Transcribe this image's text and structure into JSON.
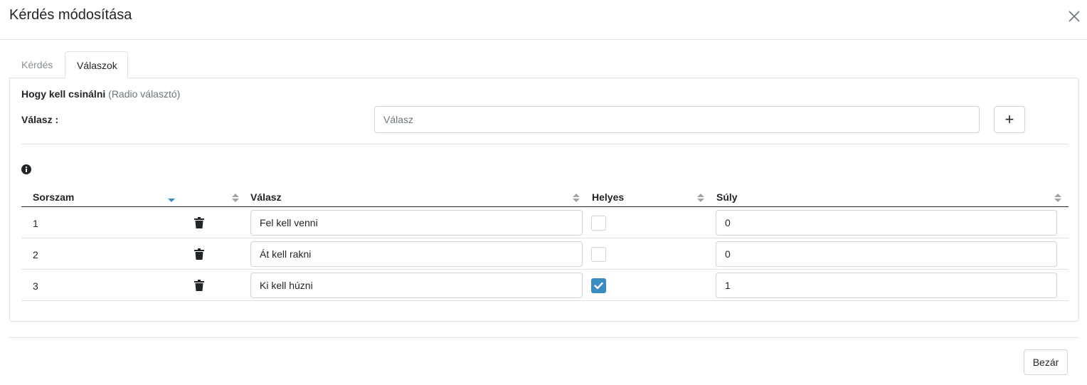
{
  "modal": {
    "title": "Kérdés módosítása",
    "close_icon": "close-icon"
  },
  "tabs": [
    {
      "label": "Kérdés",
      "active": false
    },
    {
      "label": "Válaszok",
      "active": true
    }
  ],
  "question": {
    "type_strong": "Hogy kell csinálni",
    "type_muted": "(Radio választó)"
  },
  "answer_form": {
    "label": "Válasz :",
    "input_value": "",
    "input_placeholder": "Válasz",
    "add_button_label": "+"
  },
  "info_icon": "info-circle-icon",
  "table": {
    "columns": [
      "Sorszam",
      "Válasz",
      "Helyes",
      "Súly"
    ],
    "sort": {
      "column": "Sorszam",
      "direction": "desc"
    },
    "rows": [
      {
        "order": "1",
        "answer": "Fel kell venni",
        "correct": false,
        "weight": "0"
      },
      {
        "order": "2",
        "answer": "Át kell rakni",
        "correct": false,
        "weight": "0"
      },
      {
        "order": "3",
        "answer": "Ki kell húzni",
        "correct": true,
        "weight": "1"
      }
    ]
  },
  "footer": {
    "close_button_label": "Bezár"
  },
  "colors": {
    "accent": "#3a8ac4",
    "sort_active": "#3a8ac4",
    "border": "#dee2e6"
  }
}
